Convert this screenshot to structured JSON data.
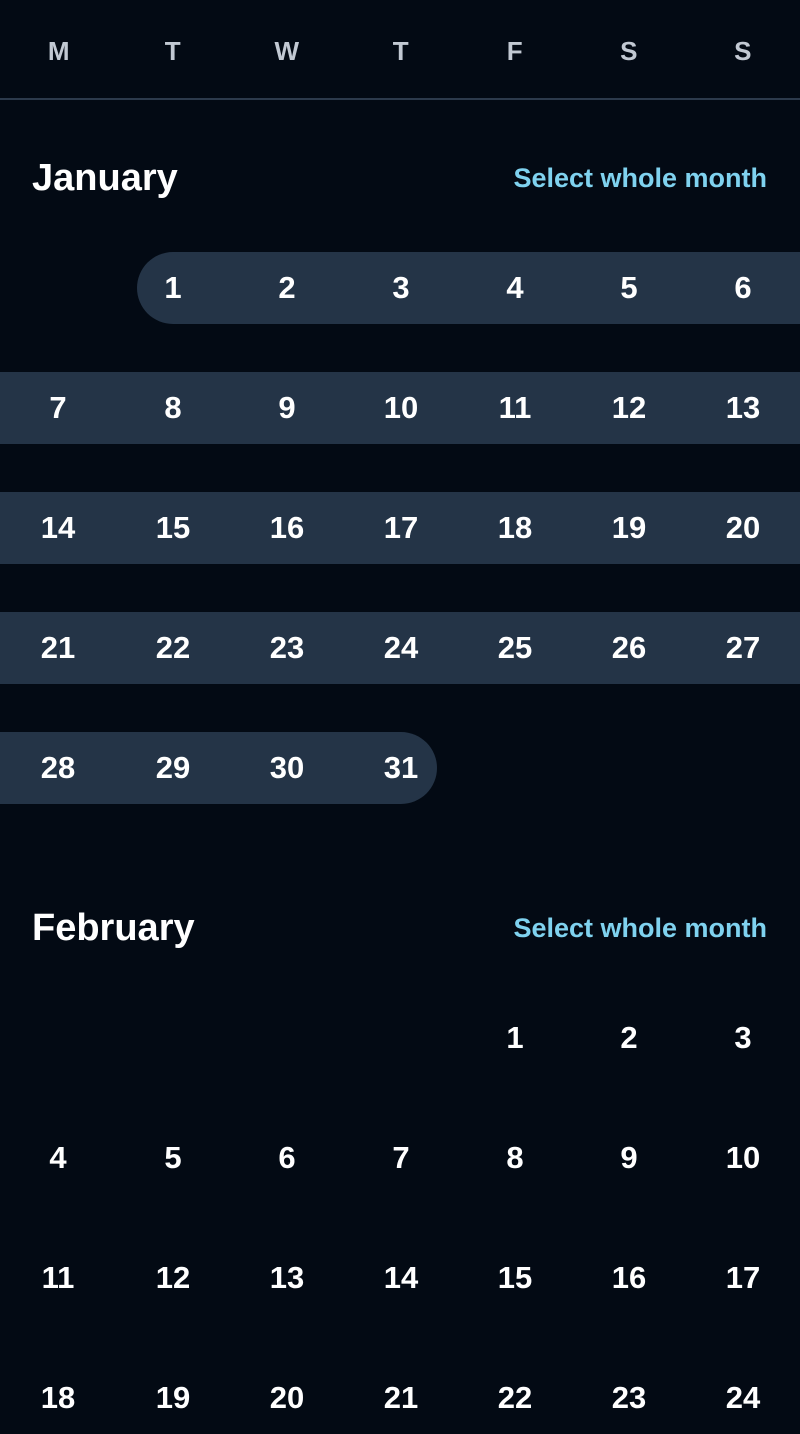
{
  "weekdays": [
    "M",
    "T",
    "W",
    "T",
    "F",
    "S",
    "S"
  ],
  "months": [
    {
      "name": "January",
      "select_label": "Select whole month",
      "selected_range": true,
      "weeks": [
        [
          "",
          "1",
          "2",
          "3",
          "4",
          "5",
          "6"
        ],
        [
          "7",
          "8",
          "9",
          "10",
          "11",
          "12",
          "13"
        ],
        [
          "14",
          "15",
          "16",
          "17",
          "18",
          "19",
          "20"
        ],
        [
          "21",
          "22",
          "23",
          "24",
          "25",
          "26",
          "27"
        ],
        [
          "28",
          "29",
          "30",
          "31",
          "",
          "",
          ""
        ]
      ]
    },
    {
      "name": "February",
      "select_label": "Select whole month",
      "selected_range": false,
      "weeks": [
        [
          "",
          "",
          "",
          "",
          "1",
          "2",
          "3"
        ],
        [
          "4",
          "5",
          "6",
          "7",
          "8",
          "9",
          "10"
        ],
        [
          "11",
          "12",
          "13",
          "14",
          "15",
          "16",
          "17"
        ],
        [
          "18",
          "19",
          "20",
          "21",
          "22",
          "23",
          "24"
        ]
      ]
    }
  ],
  "colors": {
    "background": "#030a14",
    "range_fill": "#243447",
    "accent": "#7fd2ef",
    "weekday_text": "#c2c9d3"
  }
}
